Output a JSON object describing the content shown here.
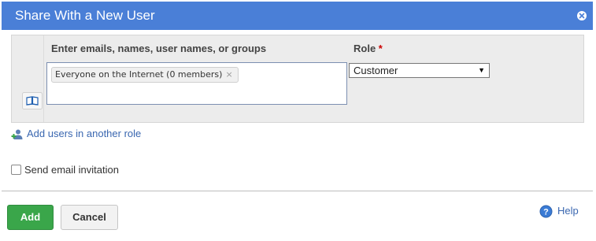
{
  "dialog": {
    "title": "Share With a New User",
    "close_icon": "close-icon"
  },
  "share_panel": {
    "recipients_label": "Enter emails, names, user names, or groups",
    "role_label": "Role",
    "required_marker": "*",
    "address_book_icon": "address-book-icon",
    "recipients": [
      {
        "label": "Everyone on the Internet (0 members)",
        "remove": "×"
      }
    ],
    "role_select": {
      "value": "Customer",
      "arrow": "▼"
    }
  },
  "add_role": {
    "icon": "add-user-icon",
    "label": "Add users in another role"
  },
  "send_invite": {
    "label": "Send email invitation",
    "checked": false
  },
  "footer": {
    "add_label": "Add",
    "cancel_label": "Cancel",
    "help_label": "Help",
    "help_icon": "help-icon"
  },
  "colors": {
    "header": "#4a7fd7",
    "add_button": "#3aa64a",
    "link": "#3a67b0",
    "required": "#cc0000"
  }
}
